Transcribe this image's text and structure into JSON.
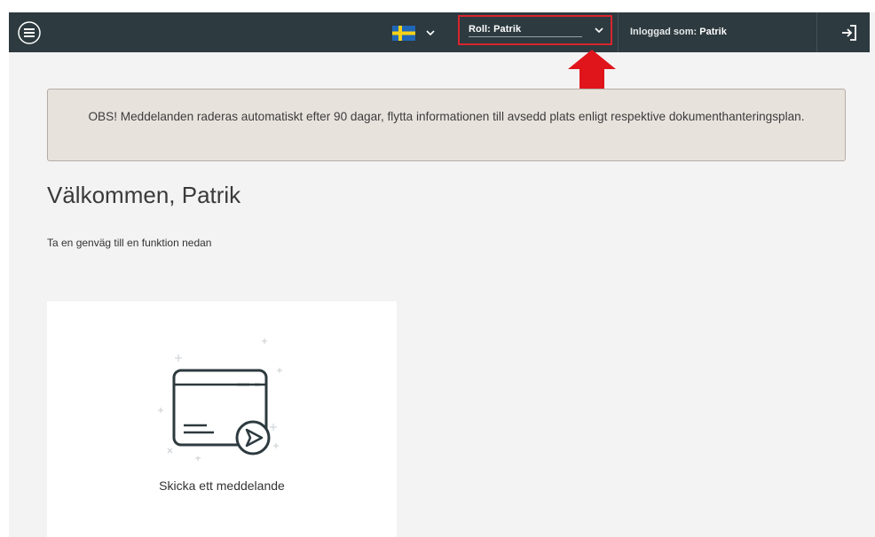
{
  "topbar": {
    "menu_icon": "hamburger-menu-icon",
    "language": {
      "flag": "swedish-flag-icon",
      "chevron": "chevron-down-icon"
    },
    "role_select": {
      "label": "Roll: Patrik",
      "chevron": "chevron-down-icon",
      "highlight_color": "#d9242d"
    },
    "logged_in": {
      "prefix": "Inloggad som:",
      "user": "Patrik"
    },
    "logout_icon": "logout-icon",
    "background": "#2d3a3f"
  },
  "annotation": {
    "arrow_color": "#e0141b"
  },
  "notice": {
    "text": "OBS! Meddelanden raderas automatiskt efter 90 dagar, flytta informationen till avsedd plats enligt respektive dokumenthanteringsplan."
  },
  "main": {
    "welcome": "Välkommen, Patrik",
    "subtitle": "Ta en genväg till en funktion nedan",
    "cards": [
      {
        "label": "Skicka ett meddelande",
        "icon": "send-message-icon"
      }
    ]
  }
}
